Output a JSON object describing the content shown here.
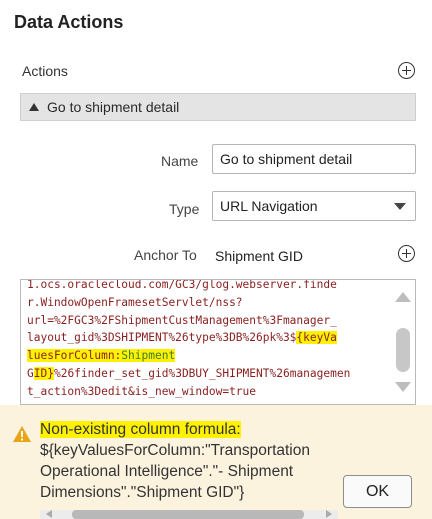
{
  "panel": {
    "title": "Data Actions"
  },
  "actions": {
    "label": "Actions",
    "add_icon": "plus-circle-icon",
    "items": [
      {
        "label": "Go to shipment detail",
        "expanded": true
      }
    ]
  },
  "form": {
    "name_label": "Name",
    "name_value": "Go to shipment detail",
    "type_label": "Type",
    "type_value": "URL Navigation",
    "anchor_label": "Anchor To",
    "anchor_value": "Shipment GID",
    "anchor_add_icon": "plus-circle-icon"
  },
  "url": {
    "line1": "1.ocs.oraclecloud.com/GC3/glog.webserver.finde",
    "line2": "r.WindowOpenFramesetServlet/nss?",
    "line3": "url=%2FGC3%2FShipmentCustManagement%3Fmanager_",
    "line4a": "layout_gid%3DSHIPMENT%26type%3DB%26pk%3$",
    "line4b": "{keyVa",
    "line5a": "luesForColumn:",
    "line5b": "Shipment",
    "line6a": "G",
    "line6b": "ID}",
    "line6c": "%26finder_set_gid%3DBUY_SHIPMENT%26managemen",
    "line7": "t_action%3Dedit&is_new_window=true"
  },
  "warning": {
    "icon": "warning-triangle-icon",
    "line1": "Non-existing column formula:",
    "line2": "${keyValuesForColumn:\"Transportation",
    "line3": "Operational Intelligence\".\"- Shipment",
    "line4": "Dimensions\".\"Shipment GID\"}",
    "ok_label": "OK"
  },
  "colors": {
    "warning_bg": "#fcf3df",
    "highlight": "#fff200",
    "url_text": "#8a1f1f",
    "warning_icon": "#e8a317"
  }
}
